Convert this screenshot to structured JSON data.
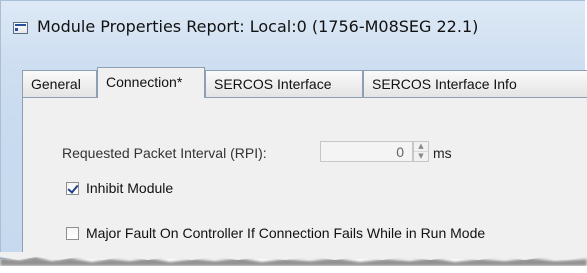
{
  "window": {
    "title": "Module Properties Report: Local:0 (1756-M08SEG 22.1)",
    "icon": "module-window-icon"
  },
  "tabs": [
    {
      "label": "General",
      "active": false
    },
    {
      "label": "Connection*",
      "active": true
    },
    {
      "label": "SERCOS Interface",
      "active": false
    },
    {
      "label": "SERCOS Interface Info",
      "active": false
    }
  ],
  "connection": {
    "rpi_label": "Requested Packet Interval (RPI):",
    "rpi_value": "0",
    "rpi_unit": "ms",
    "inhibit_module": {
      "label": "Inhibit Module",
      "checked": true
    },
    "major_fault": {
      "label": "Major Fault On Controller If Connection Fails While in Run Mode",
      "checked": false
    }
  },
  "icons": {
    "spin_up": "spin-up-arrow-icon",
    "spin_down": "spin-down-arrow-icon"
  }
}
